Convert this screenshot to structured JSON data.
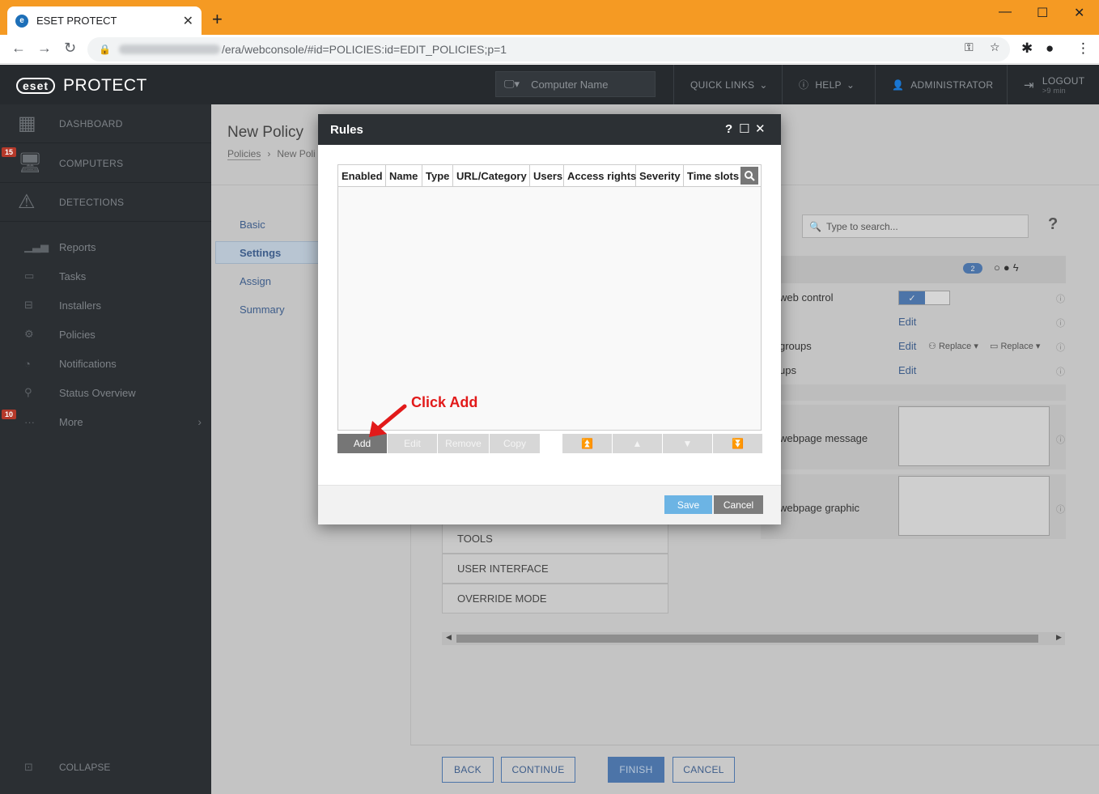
{
  "browser": {
    "tab_title": "ESET PROTECT",
    "tab_favicon": "e",
    "new_tab": "+",
    "url_path": "/era/webconsole/#id=POLICIES:id=EDIT_POLICIES;p=1"
  },
  "header": {
    "logo_badge": "eset",
    "logo_text": "PROTECT",
    "search_placeholder": "Computer Name",
    "quick_links": "QUICK LINKS",
    "help": "HELP",
    "admin": "ADMINISTRATOR",
    "logout": "LOGOUT",
    "logout_sub": ">9 min"
  },
  "sidebar": {
    "dashboard": "DASHBOARD",
    "computers": "COMPUTERS",
    "computers_badge": "15",
    "detections": "DETECTIONS",
    "items": [
      "Reports",
      "Tasks",
      "Installers",
      "Policies",
      "Notifications",
      "Status Overview",
      "More"
    ],
    "more_badge": "10",
    "collapse": "COLLAPSE"
  },
  "page": {
    "title": "New Policy",
    "breadcrumb_root": "Policies",
    "breadcrumb_current": "New Poli",
    "steps": [
      "Basic",
      "Settings",
      "Assign",
      "Summary"
    ],
    "right_search": "Type to search...",
    "count_badge": "2",
    "rows": [
      "web control",
      "groups",
      "ups"
    ],
    "edit_label": "Edit",
    "replace_label": "Replace",
    "webpage_message": "webpage message",
    "webpage_graphic": "webpage graphic",
    "sections": [
      "TOOLS",
      "USER INTERFACE",
      "OVERRIDE MODE"
    ],
    "footer_buttons": [
      "BACK",
      "CONTINUE",
      "FINISH",
      "CANCEL"
    ]
  },
  "modal": {
    "title": "Rules",
    "columns": [
      "Enabled",
      "Name",
      "Type",
      "URL/Category",
      "Users",
      "Access rights",
      "Severity",
      "Time slots"
    ],
    "buttons": [
      "Add",
      "Edit",
      "Remove",
      "Copy"
    ],
    "save": "Save",
    "cancel": "Cancel"
  },
  "annotation": "Click Add"
}
